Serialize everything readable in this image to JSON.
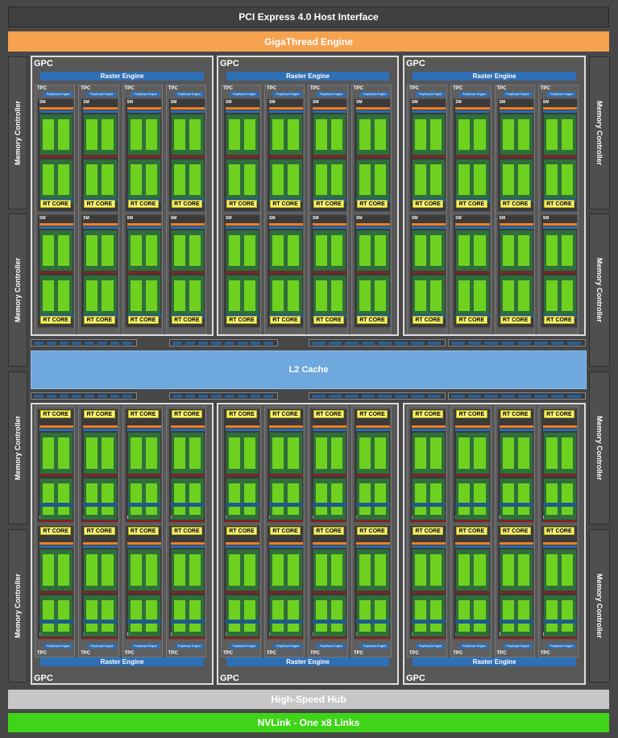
{
  "title_bar": "PCI Express 4.0 Host Interface",
  "gigathread": "GigaThread Engine",
  "memory_controller_label": "Memory Controller",
  "gpc_label": "GPC",
  "raster_engine_label": "Raster Engine",
  "tpc_label": "TPC",
  "polymorph_label": "PolyMorph Engine",
  "sm_label": "SM",
  "rt_core_label": "RT CORE",
  "l2_cache": "L2 Cache",
  "high_speed_hub": "High-Speed Hub",
  "nvlink": "NVLink - One x8 Links",
  "colors": {
    "background": "#474747",
    "gigathread": "#f7a24f",
    "raster_engine": "#2f6fb5",
    "rt_core": "#f8f07a",
    "core": "#6fd11f",
    "l2_cache": "#6fa8dc",
    "high_speed_hub": "#c7c7c7",
    "nvlink": "#3fd417"
  }
}
